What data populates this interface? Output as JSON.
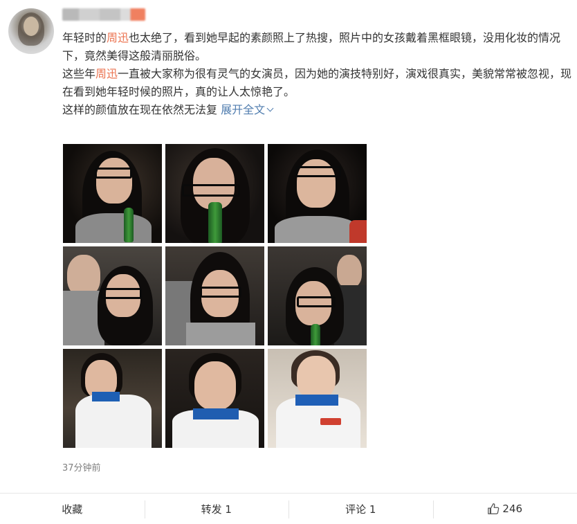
{
  "post": {
    "paragraph1": {
      "prefix": "年轻时的",
      "mention": "周迅",
      "suffix": "也太绝了，看到她早起的素颜照上了热搜，照片中的女孩戴着黑框眼镜，没用化妆的情况下，竟然美得这般清丽脱俗。"
    },
    "paragraph2": {
      "prefix": "这些年",
      "mention": "周迅",
      "suffix": "一直被大家称为很有灵气的女演员，因为她的演技特别好，演戏很真实，美貌常常被忽视，现在看到她年轻时候的照片，真的让人太惊艳了。"
    },
    "paragraph3": {
      "text": "这样的颜值放在现在依然无法复",
      "expand_label": "展开全文"
    },
    "timestamp": "37分钟前"
  },
  "photos": [
    {
      "name": "photo-1",
      "scene": "glasses-bottle"
    },
    {
      "name": "photo-2",
      "scene": "glasses-smile-bottle"
    },
    {
      "name": "photo-3",
      "scene": "glasses-tilt"
    },
    {
      "name": "photo-4",
      "scene": "glasses-crowd"
    },
    {
      "name": "photo-5",
      "scene": "glasses-crowd"
    },
    {
      "name": "photo-6",
      "scene": "glasses-crowd"
    },
    {
      "name": "photo-7",
      "scene": "uniform-seated"
    },
    {
      "name": "photo-8",
      "scene": "uniform-hand-face"
    },
    {
      "name": "photo-9",
      "scene": "uniform-hand-face-light"
    }
  ],
  "actions": {
    "favorite_label": "收藏",
    "repost_label": "转发 1",
    "comment_label": "评论 1",
    "like_count": "246"
  },
  "icons": {
    "like": "thumbs-up-icon",
    "expand": "chevron-down-icon"
  },
  "colors": {
    "mention": "#eb7350",
    "link": "#507daf",
    "meta": "#808080"
  }
}
